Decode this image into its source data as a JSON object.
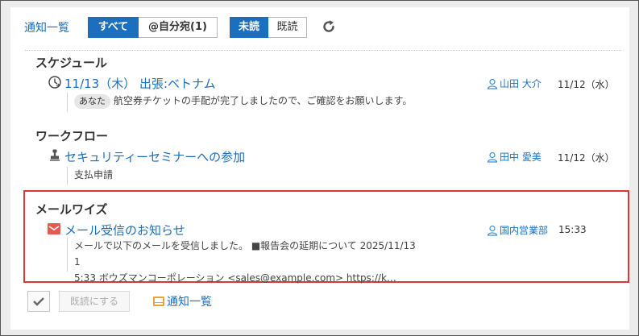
{
  "toolbar": {
    "title": "通知一覧",
    "filter_all": "すべて",
    "filter_mine": "@自分宛(1)",
    "filter_unread": "未読",
    "filter_read": "既読"
  },
  "sections": [
    {
      "title": "スケジュール",
      "item": {
        "link": "11/13（木） 出張:ベトナム",
        "badge": "あなた",
        "body": "航空券チケットの手配が完了しましたので、ご確認をお願いします。",
        "sender": "山田 大介",
        "date": "11/12（水）"
      }
    },
    {
      "title": "ワークフロー",
      "item": {
        "link": "セキュリティーセミナーへの参加",
        "body": "支払申請",
        "sender": "田中 愛美",
        "date": "11/12（水）"
      }
    },
    {
      "title": "メールワイズ",
      "item": {
        "link": "メール受信のお知らせ",
        "body_line1": "メールで以下のメールを受信しました。 ■報告会の延期について 2025/11/13 1",
        "body_line2": "5:33 ボウズマンコーポレーション <sales@example.com> https://k…",
        "sender": "国内営業部",
        "date": "15:33"
      }
    }
  ],
  "footer": {
    "mark_read": "既読にする",
    "list_link": "通知一覧"
  },
  "colors": {
    "accent": "#1a6fbf",
    "highlight": "#e03535"
  }
}
